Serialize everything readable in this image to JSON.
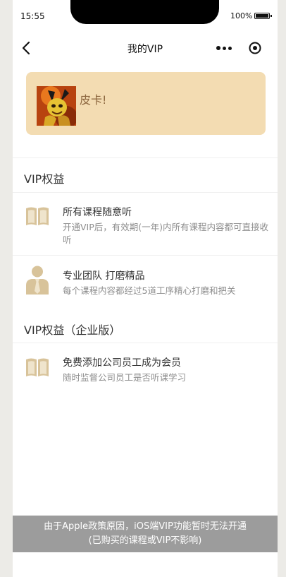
{
  "status_bar": {
    "time": "15:55",
    "battery": "100%"
  },
  "nav": {
    "title": "我的VIP",
    "back_icon": "chevron-left-icon",
    "more_icon": "more-dots-icon",
    "close_icon": "target-circle-icon"
  },
  "user": {
    "name": "皮卡!"
  },
  "colors": {
    "card_bg": "#f3dcb2",
    "icon_gold": "#d8c39a",
    "notice_bg": "#9c9c9c",
    "name_color": "#8d6840"
  },
  "sections": {
    "vip_title": "VIP权益",
    "enterprise_title": "VIP权益（企业版）"
  },
  "benefits": [
    {
      "icon": "open-book-icon",
      "title": "所有课程随意听",
      "desc": "开通VIP后，有效期(一年)内所有课程内容都可直接收听"
    },
    {
      "icon": "person-tie-icon",
      "title": "专业团队 打磨精品",
      "desc": "每个课程内容都经过5道工序精心打磨和把关"
    }
  ],
  "enterprise_benefits": [
    {
      "icon": "open-book-icon",
      "title": "免费添加公司员工成为会员",
      "desc": "随时监督公司员工是否听课学习"
    }
  ],
  "notice": {
    "line1": "由于Apple政策原因，iOS端VIP功能暂时无法开通",
    "line2": "(已购买的课程或VIP不影响)"
  }
}
